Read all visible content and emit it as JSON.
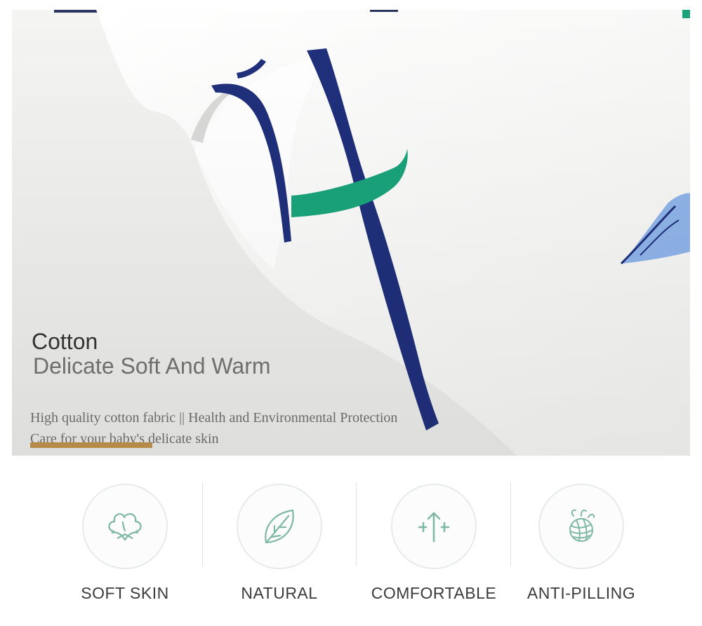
{
  "hero": {
    "title": "Cotton",
    "subtitle": "Delicate Soft And Warm",
    "description_line1": "High quality cotton fabric || Health and Environmental Protection",
    "description_line2": "Care for your baby's delicate skin",
    "accent_color": "#b68b4a"
  },
  "features": [
    {
      "label": "SOFT SKIN",
      "icon": "cotton-flower-icon"
    },
    {
      "label": "NATURAL",
      "icon": "leaf-icon"
    },
    {
      "label": "COMFORTABLE",
      "icon": "stretch-arrows-icon"
    },
    {
      "label": "ANTI-PILLING",
      "icon": "yarn-ball-icon"
    }
  ],
  "colors": {
    "navy": "#1f2f7a",
    "green": "#1aa37a",
    "light_blue": "#8fb3e8",
    "icon_green": "#7fb8a6"
  }
}
